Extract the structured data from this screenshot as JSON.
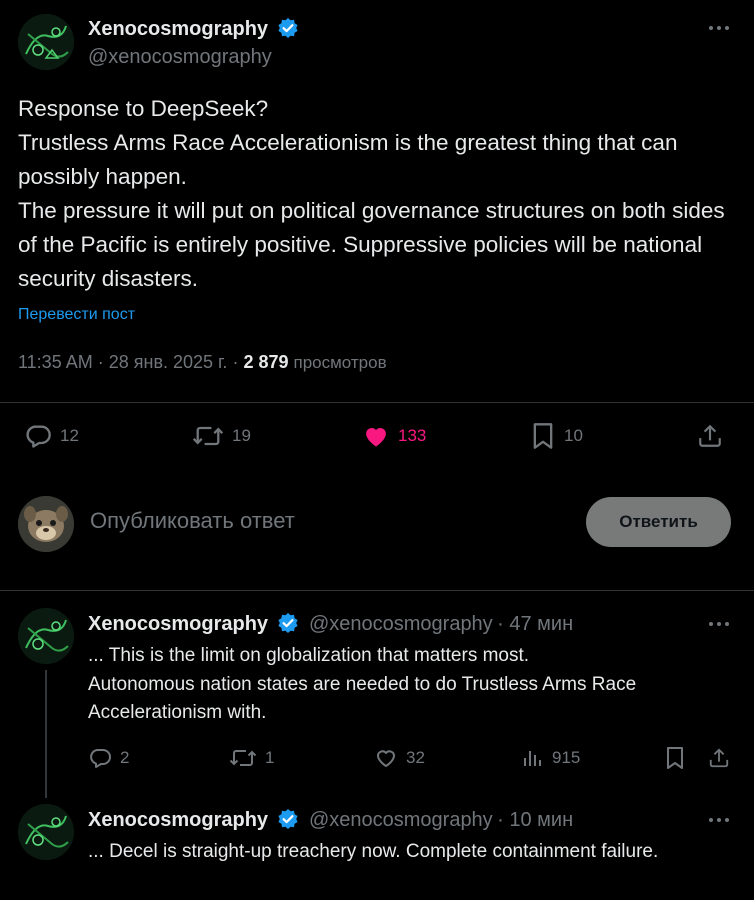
{
  "main_tweet": {
    "display_name": "Xenocosmography",
    "handle": "@xenocosmography",
    "text": "Response to DeepSeek?\nTrustless Arms Race Accelerationism is the greatest thing that can possibly happen.\nThe pressure it will put on political governance structures on both sides of the Pacific is entirely positive. Suppressive policies will be national security disasters.",
    "translate_label": "Перевести пост",
    "time": "11:35 AM",
    "date": "28 янв. 2025 г.",
    "views_count": "2 879",
    "views_label": "просмотров",
    "actions": {
      "replies": "12",
      "reposts": "19",
      "likes": "133",
      "bookmarks": "10"
    }
  },
  "reply_box": {
    "placeholder": "Опубликовать ответ",
    "button_label": "Ответить"
  },
  "replies": [
    {
      "display_name": "Xenocosmography",
      "handle": "@xenocosmography",
      "time": "47 мин",
      "text": "... This is the limit on globalization that matters most.\nAutonomous nation states are needed to do Trustless Arms Race Accelerationism with.",
      "actions": {
        "replies": "2",
        "reposts": "1",
        "likes": "32",
        "views": "915"
      }
    },
    {
      "display_name": "Xenocosmography",
      "handle": "@xenocosmography",
      "time": "10 мин",
      "text": "... Decel is straight-up treachery now. Complete containment failure."
    }
  ],
  "colors": {
    "background": "#000000",
    "text": "#e7e9ea",
    "muted": "#71767b",
    "link": "#1d9bf0",
    "like": "#f91880",
    "verified": "#1d9bf0",
    "divider": "#2f3336"
  },
  "icons": [
    "verified-badge-icon",
    "more-icon",
    "reply-icon",
    "repost-icon",
    "like-icon",
    "bookmark-icon",
    "share-icon",
    "views-icon"
  ]
}
